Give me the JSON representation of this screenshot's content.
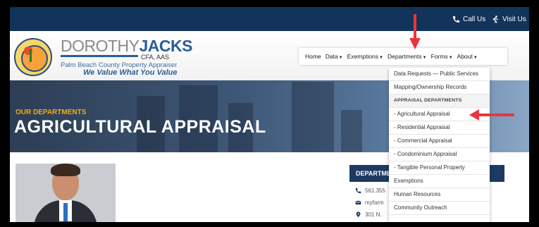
{
  "topbar": {
    "call": "Call Us",
    "visit": "Visit Us"
  },
  "logo": {
    "name_first": "DOROTHY",
    "name_last": "JACKS",
    "credentials": "CFA, AAS",
    "subtitle": "Palm Beach County Property Appraiser",
    "tagline": "We Value What You Value"
  },
  "nav": {
    "items": [
      {
        "label": "Home"
      },
      {
        "label": "Data"
      },
      {
        "label": "Exemptions"
      },
      {
        "label": "Departments"
      },
      {
        "label": "Forms"
      },
      {
        "label": "About"
      }
    ]
  },
  "hero": {
    "eyebrow": "OUR DEPARTMENTS",
    "title": "AGRICULTURAL APPRAISAL"
  },
  "dropdown": {
    "items": [
      "Data Requests — Public Services",
      "Mapping/Ownership Records",
      "APPRAISAL DEPARTMENTS",
      "- Agricultural Appraisal",
      "- Residential Appraisal",
      "- Commercial Appraisal",
      "- Condominium Appraisal",
      "- Tangible Personal Property",
      "Exemptions",
      "Human Resources",
      "Community Outreach"
    ]
  },
  "department_box": {
    "heading": "DEPARTME",
    "phone": "561.355",
    "email": "myfarm",
    "address": "301 N."
  },
  "colors": {
    "topbar": "#12335a",
    "accent": "#f4a81d",
    "annotation_arrow": "#e8353d",
    "nav_blue": "#2c5d9a"
  },
  "icons": {
    "call": "phone-icon",
    "visit": "walking-person-icon",
    "phone": "phone-icon",
    "email": "envelope-icon",
    "address": "map-pin-icon"
  }
}
